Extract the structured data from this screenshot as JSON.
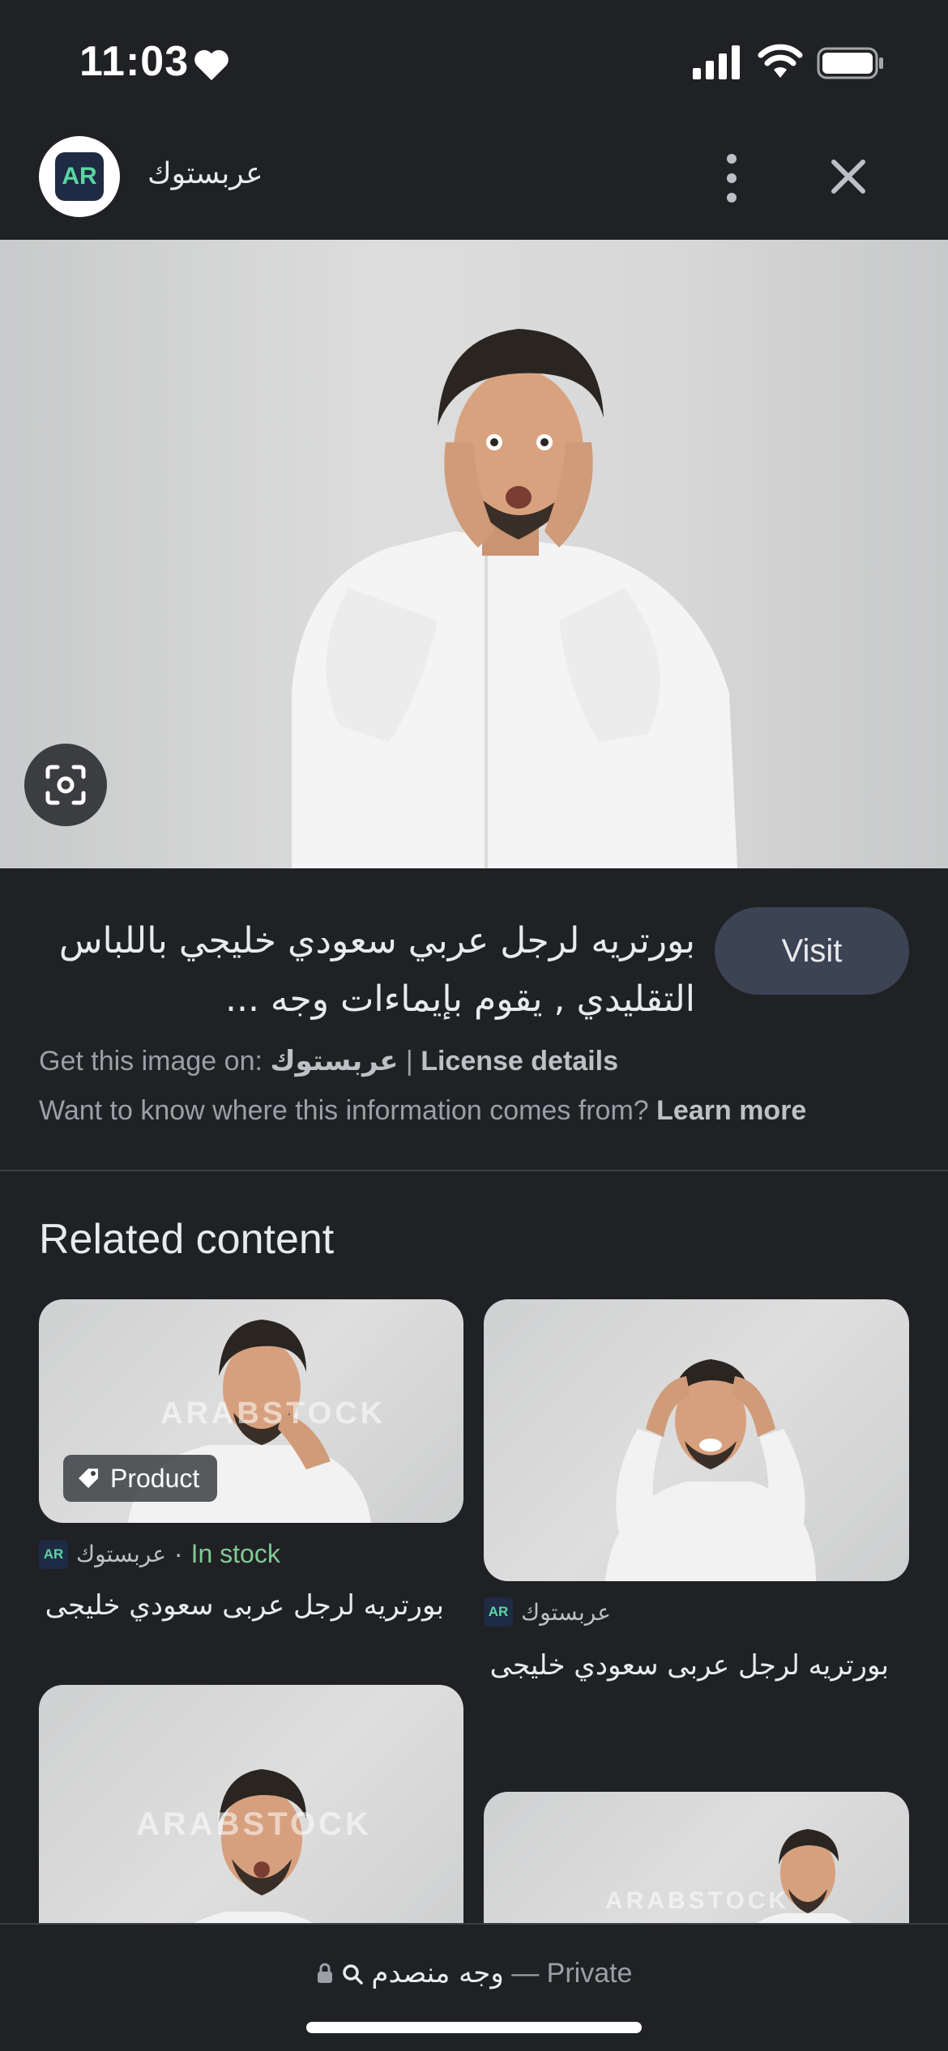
{
  "status_bar": {
    "time": "11:03"
  },
  "header": {
    "site_name": "عربستوك",
    "logo_text": "AR"
  },
  "result": {
    "title_line1": "بورتريه لرجل عربي سعودي خليجي باللباس",
    "title_line2": "التقليدي , يقوم بإيماءات وجه ...",
    "visit_label": "Visit",
    "get_image_prefix": "Get this image on: ",
    "get_image_source": "عربستوك",
    "separator": " | ",
    "license_label": "License details",
    "info_question": "Want to know where this information comes from? ",
    "learn_more": "Learn more"
  },
  "related": {
    "title": "Related content",
    "watermark": "ARABSTOCK",
    "cards": [
      {
        "badge": "Product",
        "source": "عربستوك",
        "dot": " · ",
        "availability": "In stock",
        "title": "بورتريه لرجل عربى سعودي خليجى"
      },
      {
        "source": "عربستوك",
        "title": "بورتريه لرجل عربى سعودي خليجى"
      }
    ]
  },
  "bottom_bar": {
    "query": "وجه منصدم",
    "private_label": "— Private"
  },
  "colors": {
    "background": "#202124",
    "visit_button": "#3c4353",
    "in_stock": "#81c995"
  }
}
